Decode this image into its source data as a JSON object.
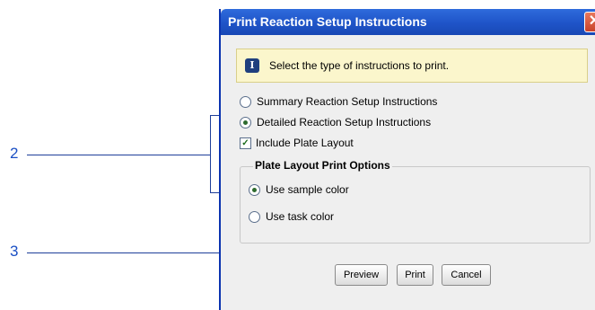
{
  "callouts": [
    "2",
    "3"
  ],
  "dialog": {
    "title": "Print Reaction Setup Instructions",
    "close_glyph": "✕",
    "info_icon_glyph": "I",
    "info_text": "Select the type of instructions to print.",
    "options": {
      "summary": "Summary Reaction Setup Instructions",
      "detailed": "Detailed Reaction Setup Instructions",
      "include_plate_layout": "Include Plate Layout"
    },
    "include_plate_layout_checked": true,
    "selected_instruction_type": "detailed",
    "group": {
      "title": "Plate Layout Print Options",
      "sample_color": "Use sample color",
      "task_color": "Use task color",
      "selected": "sample_color"
    },
    "buttons": {
      "preview": "Preview",
      "print": "Print",
      "cancel": "Cancel"
    }
  }
}
